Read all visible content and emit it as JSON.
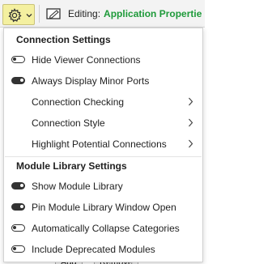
{
  "toolbar": {
    "gear_icon": "gear-icon",
    "chevron_icon": "chevron-down-icon",
    "edit_icon": "edit-icon",
    "editing_label": "Editing:",
    "editing_value": "Application Propertie"
  },
  "menu": {
    "connection_settings": {
      "title": "Connection Settings",
      "items": [
        {
          "label": "Hide Viewer Connections",
          "type": "toggle",
          "on": false
        },
        {
          "label": "Always Display Minor Ports",
          "type": "toggle",
          "on": true
        },
        {
          "label": "Connection Checking",
          "type": "submenu"
        },
        {
          "label": "Connection Style",
          "type": "submenu"
        },
        {
          "label": "Highlight Potential Connections",
          "type": "submenu"
        }
      ]
    },
    "module_library_settings": {
      "title": "Module Library Settings",
      "items": [
        {
          "label": "Show Module Library",
          "type": "toggle",
          "on": true
        },
        {
          "label": "Pin Module Library Window Open",
          "type": "toggle",
          "on": true
        },
        {
          "label": "Automatically Collapse Categories",
          "type": "toggle",
          "on": false
        },
        {
          "label": "Include Deprecated Modules",
          "type": "toggle",
          "on": false
        }
      ]
    }
  },
  "underlay": {
    "add_label": "Add",
    "remove_label": "Remove"
  }
}
